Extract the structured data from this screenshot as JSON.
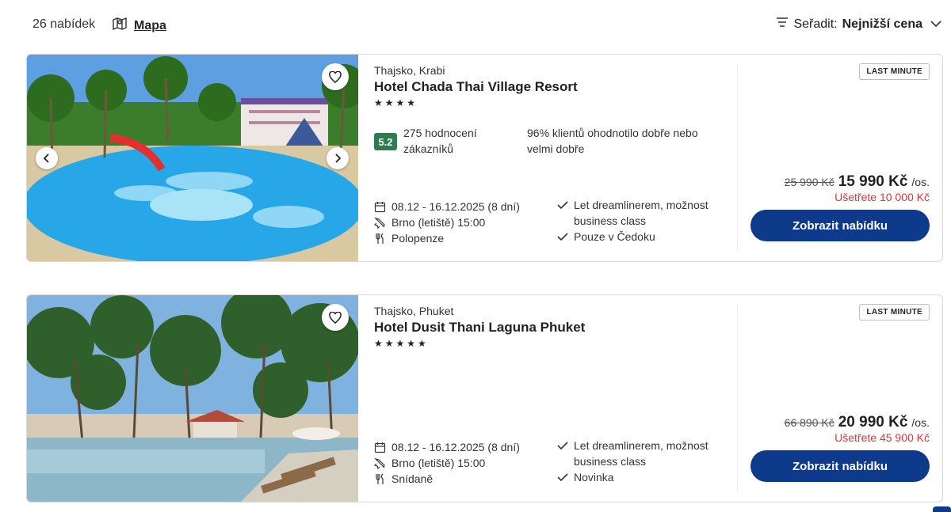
{
  "header": {
    "offers_count": "26 nabídek",
    "map_label": "Mapa",
    "sort_label": "Seřadit:",
    "sort_value": "Nejnižší cena"
  },
  "offers": [
    {
      "destination": "Thajsko, Krabi",
      "hotel": "Hotel Chada Thai Village Resort",
      "stars": "★★★★",
      "rating_score": "5.2",
      "rating_count": "275 hodnocení zákazníků",
      "rating_text": "96% klientů ohodnotilo dobře nebo velmi dobře",
      "dates": "08.12 - 16.12.2025 (8 dní)",
      "departure": "Brno (letiště) 15:00",
      "board": "Polopenze",
      "features": [
        "Let dreamlinerem, možnost business class",
        "Pouze v Čedoku"
      ],
      "badge": "LAST MINUTE",
      "old_price": "25 990 Kč",
      "price": "15 990 Kč",
      "per_person": "/os.",
      "savings": "Ušetřete 10 000 Kč",
      "cta": "Zobrazit nabídku"
    },
    {
      "destination": "Thajsko, Phuket",
      "hotel": "Hotel Dusit Thani Laguna Phuket",
      "stars": "★★★★★",
      "dates": "08.12 - 16.12.2025 (8 dní)",
      "departure": "Brno (letiště) 15:00",
      "board": "Snídaně",
      "features": [
        "Let dreamlinerem, možnost business class",
        "Novinka"
      ],
      "badge": "LAST MINUTE",
      "old_price": "66 890 Kč",
      "price": "20 990 Kč",
      "per_person": "/os.",
      "savings": "Ušetřete 45 900 Kč",
      "cta": "Zobrazit nabídku"
    }
  ],
  "colors": {
    "primary": "#0d3a8a",
    "rating_green": "#2e7d4f",
    "savings_red": "#d9383a"
  }
}
